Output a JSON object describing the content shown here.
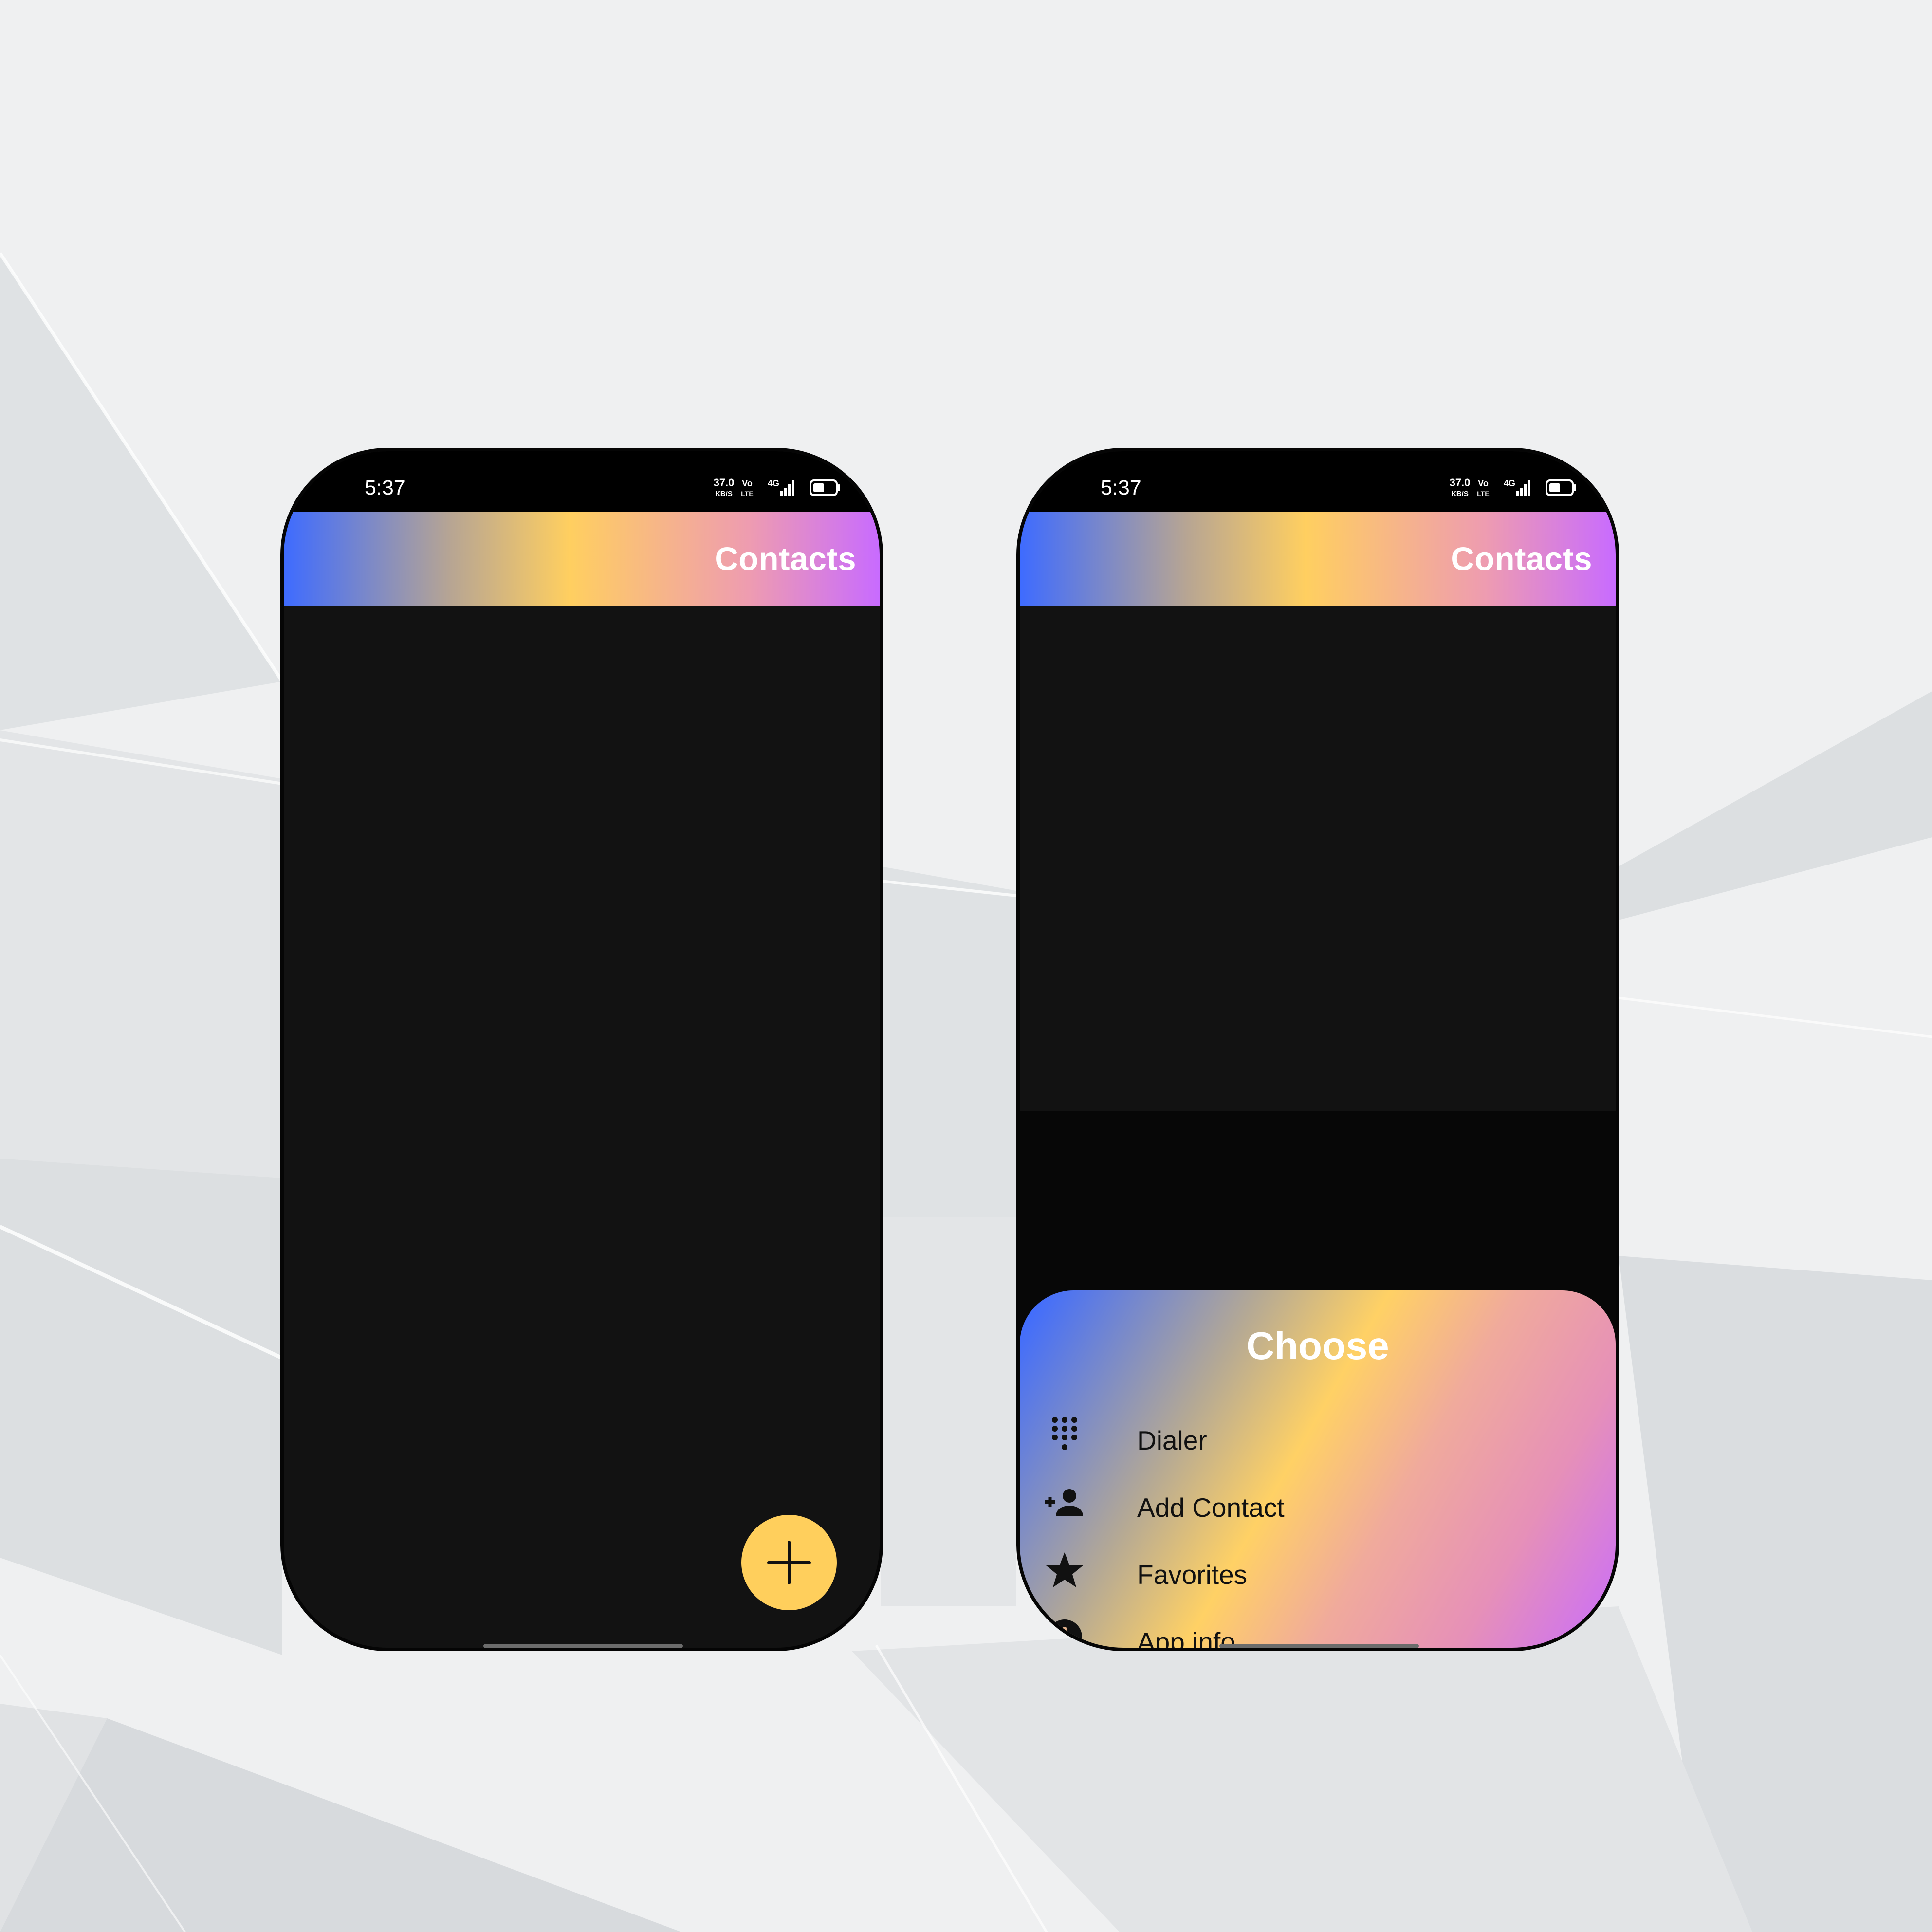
{
  "status_bar": {
    "time": "5:37",
    "net_speed_value": "37.0",
    "net_speed_unit": "KB/S",
    "volte_top": "Vo",
    "volte_bottom": "LTE",
    "network": "4G"
  },
  "appbar": {
    "title": "Contacts"
  },
  "sheet": {
    "title": "Choose",
    "items": [
      {
        "label": "Dialer",
        "icon": "dialpad-icon"
      },
      {
        "label": "Add Contact",
        "icon": "person-add-icon"
      },
      {
        "label": "Favorites",
        "icon": "star-icon"
      },
      {
        "label": "App info",
        "icon": "info-icon"
      }
    ]
  },
  "fab": {
    "icon": "plus-icon"
  },
  "colors": {
    "gradient": [
      "#3e6bff",
      "#ffcf60",
      "#c86bff"
    ],
    "fab": "#ffcf5c",
    "screen_bg": "#121212"
  }
}
